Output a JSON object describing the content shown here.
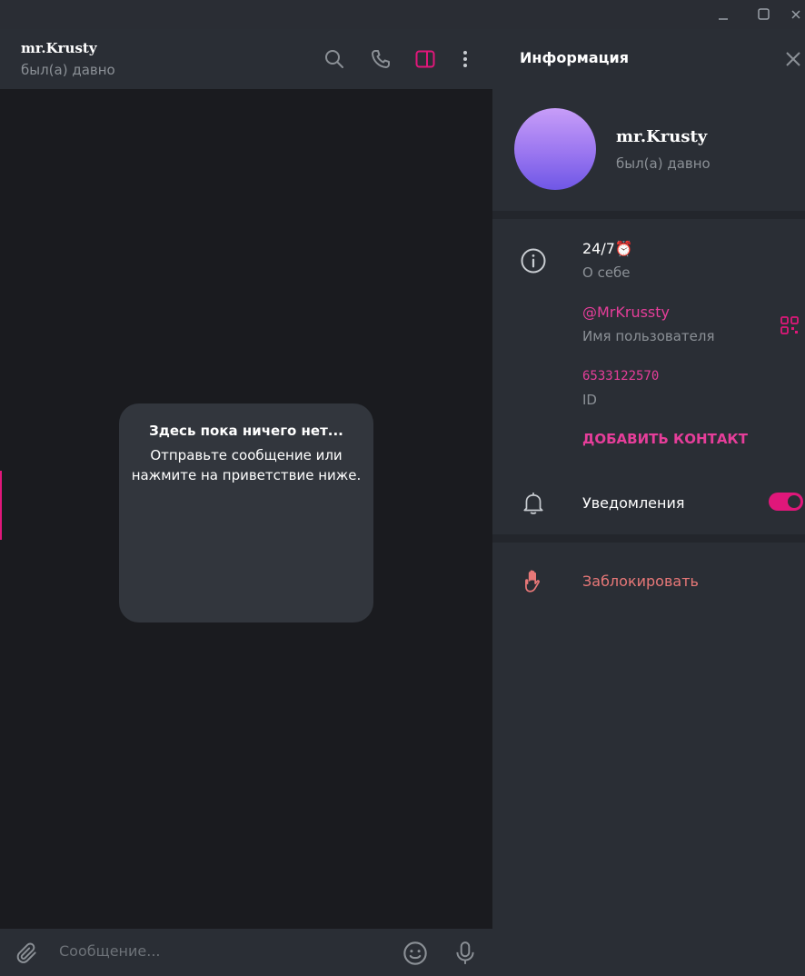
{
  "window": {
    "minimize": "–",
    "maximize": "☐",
    "close": "✕"
  },
  "chat": {
    "name": "mr.Krusty",
    "status": "был(а) давно",
    "empty_title": "Здесь пока ничего нет...",
    "empty_text": "Отправьте сообщение или нажмите на приветствие ниже.",
    "composer_placeholder": "Сообщение..."
  },
  "info_panel": {
    "title": "Информация",
    "name": "mr.Krusty",
    "status": "был(а) давно",
    "bio_value": "24/7⏰",
    "bio_label": "О себе",
    "username_value": "@MrKrussty",
    "username_label": "Имя пользователя",
    "id_value": "6533122570",
    "id_label": "ID",
    "add_contact": "ДОБАВИТЬ КОНТАКТ",
    "notifications_label": "Уведомления",
    "notifications_enabled": true,
    "block_label": "Заблокировать"
  },
  "colors": {
    "accent": "#e0177a",
    "link": "#e63e9a",
    "danger": "#e87878"
  },
  "icons": [
    "search-icon",
    "phone-icon",
    "sidebar-toggle-icon",
    "more-vertical-icon",
    "attach-icon",
    "emoji-icon",
    "mic-icon",
    "close-icon",
    "info-icon",
    "qr-code-icon",
    "bell-icon",
    "block-hand-icon"
  ]
}
